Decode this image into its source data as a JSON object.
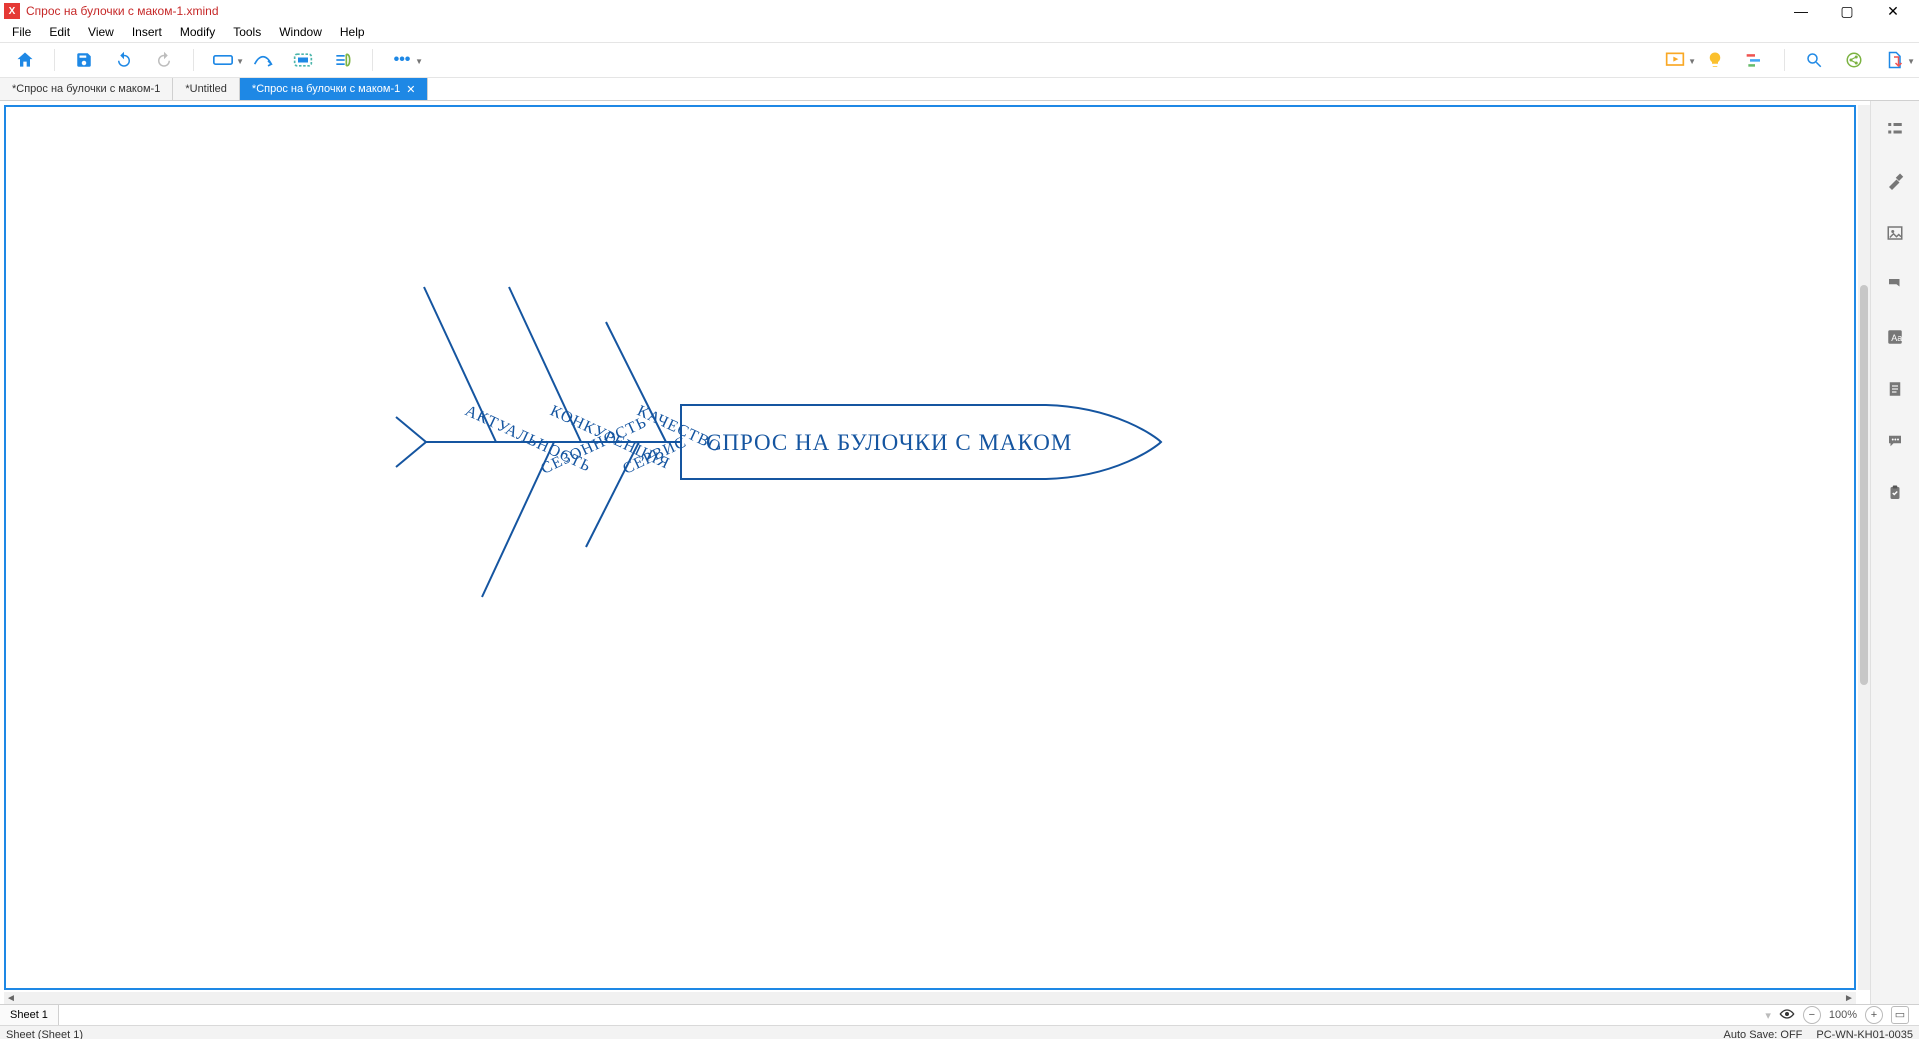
{
  "window": {
    "title": "Спрос на булочки с маком-1.xmind"
  },
  "menu": [
    "File",
    "Edit",
    "View",
    "Insert",
    "Modify",
    "Tools",
    "Window",
    "Help"
  ],
  "tabs": [
    {
      "label": "*Спрос на булочки с маком-1",
      "active": false
    },
    {
      "label": "*Untitled",
      "active": false
    },
    {
      "label": "*Спрос на булочки с маком-1",
      "active": true
    }
  ],
  "sheet": {
    "label": "Sheet 1"
  },
  "status": {
    "left": "Sheet (Sheet 1)",
    "autosave": "Auto Save: OFF",
    "host": "PC-WN-KH01-0035"
  },
  "zoom": {
    "value": "100%"
  },
  "diagram": {
    "head": "СПРОС НА БУЛОЧКИ С МАКОМ",
    "bones_top": [
      "АКТУАЛЬНОСТЬ",
      "КОНКУРЕНЦИЯ",
      "КАЧЕСТВО"
    ],
    "bones_bottom": [
      "СЕЗОННОСТЬ",
      "СЕРВИС"
    ]
  }
}
